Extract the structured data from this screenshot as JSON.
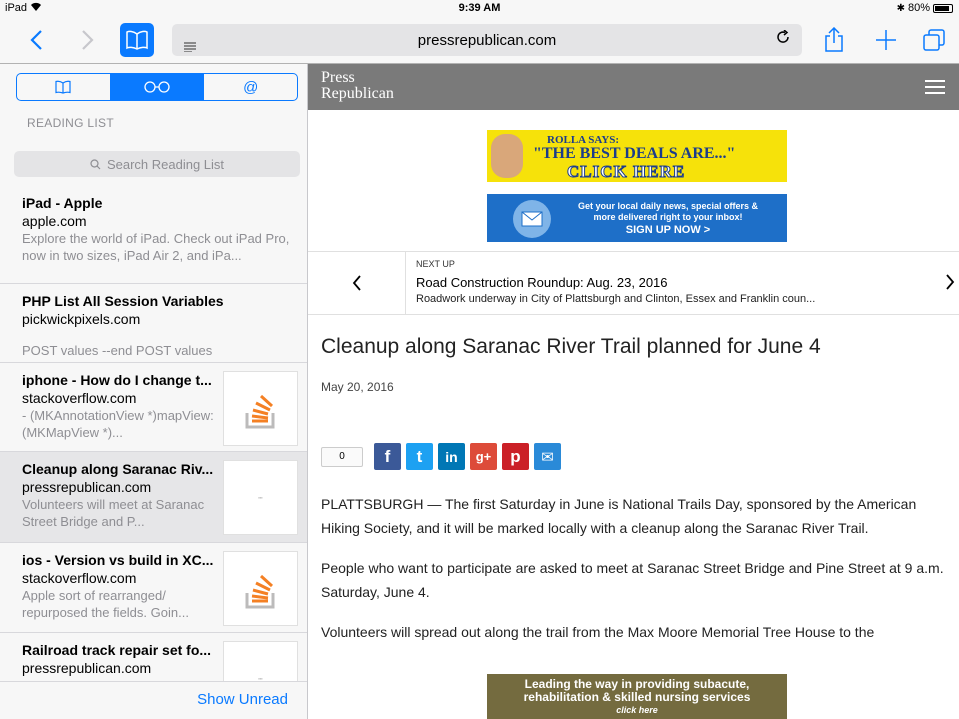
{
  "status_bar": {
    "device": "iPad",
    "time": "9:39 AM",
    "battery": "80%"
  },
  "toolbar": {
    "back_icon": "chevron-left-icon",
    "forward_icon": "chevron-right-icon",
    "url": "pressrepublican.com",
    "reload_icon": "reload-icon",
    "share_icon": "share-icon",
    "new_tab_icon": "plus-icon",
    "tabs_icon": "tabs-icon",
    "accent": "#0a7aff"
  },
  "sidebar": {
    "segments": [
      {
        "icon": "bookmark-book-icon",
        "label": ""
      },
      {
        "icon": "reading-glasses-icon",
        "label": ""
      },
      {
        "icon": "at-icon",
        "label": "@"
      }
    ],
    "section_title": "READING LIST",
    "search_placeholder": "Search Reading List",
    "items": [
      {
        "title": "iPad - Apple",
        "site": "apple.com",
        "desc": "Explore the world of iPad. Check out iPad Pro, now in two sizes, iPad Air 2, and iPa..."
      },
      {
        "title": "PHP List All Session Variables",
        "site": "pickwickpixels.com",
        "desc": "POST values --end POST values"
      },
      {
        "title": "iphone - How do I change t...",
        "site": "stackoverflow.com",
        "desc": "- (MKAnnotationView *)mapView:(MKMapView *)..."
      },
      {
        "title": "Cleanup along Saranac Riv...",
        "site": "pressrepublican.com",
        "desc": "Volunteers will meet at Saranac Street Bridge and P..."
      },
      {
        "title": "ios - Version vs build in XC...",
        "site": "stackoverflow.com",
        "desc": "Apple sort of rearranged/ repurposed the fields. Goin..."
      },
      {
        "title": "Railroad track repair set fo...",
        "site": "pressrepublican.com",
        "desc": ""
      }
    ],
    "show_unread": "Show Unread"
  },
  "page": {
    "logo_line1": "Press",
    "logo_line2": "Republican",
    "ad1": {
      "line1": "ROLLA SAYS:",
      "line2": "\"THE BEST DEALS ARE...\"",
      "line3": "CLICK HERE"
    },
    "ad2": {
      "line1": "Get your local daily news, special offers & more delivered right to your inbox!",
      "line2": "SIGN UP NOW >"
    },
    "next_up": {
      "label": "NEXT UP",
      "headline": "Road Construction Roundup: Aug. 23, 2016",
      "summary": "Roadwork underway in City of Plattsburgh and Clinton, Essex and Franklin coun..."
    },
    "article": {
      "title": "Cleanup along Saranac River Trail planned for June 4",
      "date": "May 20, 2016",
      "share_count": "0",
      "paragraphs": [
        "PLATTSBURGH — The first Saturday in June is National Trails Day, sponsored by the American Hiking Society, and it will be marked locally with a cleanup along the Saranac River Trail.",
        "People who want to participate are asked to meet at Saranac Street Bridge and Pine Street at 9 a.m. Saturday, June 4.",
        "Volunteers will spread out along the trail from the Max Moore Memorial Tree House to the"
      ]
    },
    "ad3": {
      "line1": "Leading the way in providing subacute,",
      "line2": "rehabilitation & skilled nursing services",
      "line3": "click here"
    },
    "share_buttons": [
      {
        "icon": "facebook-icon",
        "color": "#3b5998",
        "glyph": "f"
      },
      {
        "icon": "twitter-icon",
        "color": "#1da1f2",
        "glyph": "t"
      },
      {
        "icon": "linkedin-icon",
        "color": "#0077b5",
        "glyph": "in"
      },
      {
        "icon": "google-plus-icon",
        "color": "#dd4b39",
        "glyph": "g+"
      },
      {
        "icon": "pinterest-icon",
        "color": "#cb2027",
        "glyph": "p"
      },
      {
        "icon": "email-icon",
        "color": "#2a8ad8",
        "glyph": "✉"
      }
    ]
  }
}
